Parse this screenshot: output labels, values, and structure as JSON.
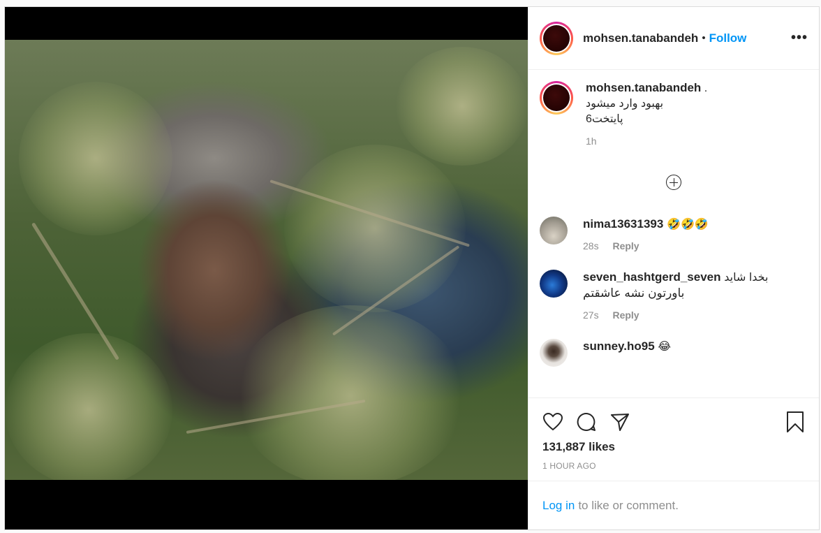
{
  "post": {
    "author": "mohsen.tanabandeh",
    "follow_label": "Follow",
    "dot": "•",
    "more_label": "•••"
  },
  "caption": {
    "username": "mohsen.tanabandeh",
    "suffix": ".",
    "line1": "بهبود وارد میشود",
    "line2": "پایتخت6",
    "time": "1h"
  },
  "comments": [
    {
      "username": "nima13631393",
      "text": "🤣🤣🤣",
      "time": "28s",
      "reply": "Reply"
    },
    {
      "username": "seven_hashtgerd_seven",
      "text": "بخدا شاید",
      "text2": "باورتون نشه عاشقتم",
      "time": "27s",
      "reply": "Reply"
    },
    {
      "username": "sunney.ho95",
      "text": "😂"
    }
  ],
  "actions": {
    "likes": "131,887 likes",
    "time": "1 HOUR AGO"
  },
  "login": {
    "link": "Log in",
    "rest": "to like or comment."
  }
}
